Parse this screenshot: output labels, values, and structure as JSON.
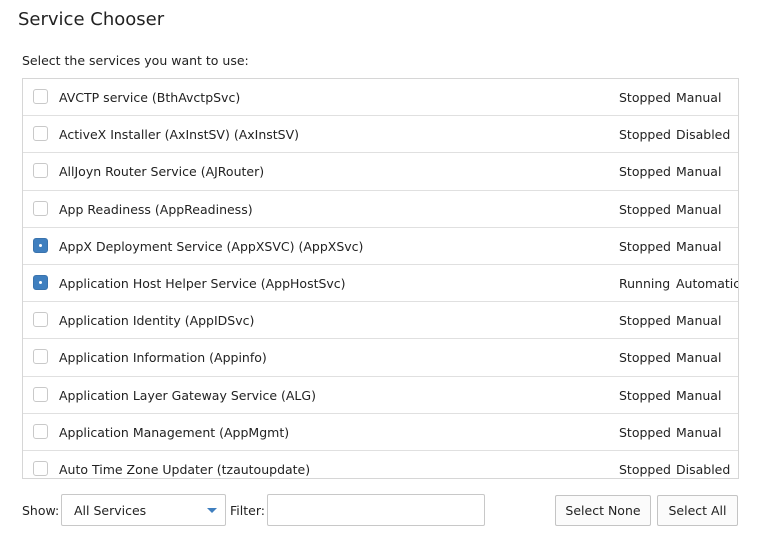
{
  "title": "Service Chooser",
  "subtitle": "Select the services you want to use:",
  "services": [
    {
      "name": "AVCTP service (BthAvctpSvc)",
      "status": "Stopped",
      "startup": "Manual",
      "checked": false
    },
    {
      "name": "ActiveX Installer (AxInstSV) (AxInstSV)",
      "status": "Stopped",
      "startup": "Disabled",
      "checked": false
    },
    {
      "name": "AllJoyn Router Service (AJRouter)",
      "status": "Stopped",
      "startup": "Manual",
      "checked": false
    },
    {
      "name": "App Readiness (AppReadiness)",
      "status": "Stopped",
      "startup": "Manual",
      "checked": false
    },
    {
      "name": "AppX Deployment Service (AppXSVC) (AppXSvc)",
      "status": "Stopped",
      "startup": "Manual",
      "checked": true
    },
    {
      "name": "Application Host Helper Service (AppHostSvc)",
      "status": "Running",
      "startup": "Automatic",
      "checked": true
    },
    {
      "name": "Application Identity (AppIDSvc)",
      "status": "Stopped",
      "startup": "Manual",
      "checked": false
    },
    {
      "name": "Application Information (Appinfo)",
      "status": "Stopped",
      "startup": "Manual",
      "checked": false
    },
    {
      "name": "Application Layer Gateway Service (ALG)",
      "status": "Stopped",
      "startup": "Manual",
      "checked": false
    },
    {
      "name": "Application Management (AppMgmt)",
      "status": "Stopped",
      "startup": "Manual",
      "checked": false
    },
    {
      "name": "Auto Time Zone Updater (tzautoupdate)",
      "status": "Stopped",
      "startup": "Disabled",
      "checked": false
    }
  ],
  "footer": {
    "show_label": "Show:",
    "show_value": "All Services",
    "filter_label": "Filter:",
    "filter_value": "",
    "select_none_label": "Select None",
    "select_all_label": "Select All"
  },
  "colors": {
    "accent": "#3f7fbf"
  }
}
